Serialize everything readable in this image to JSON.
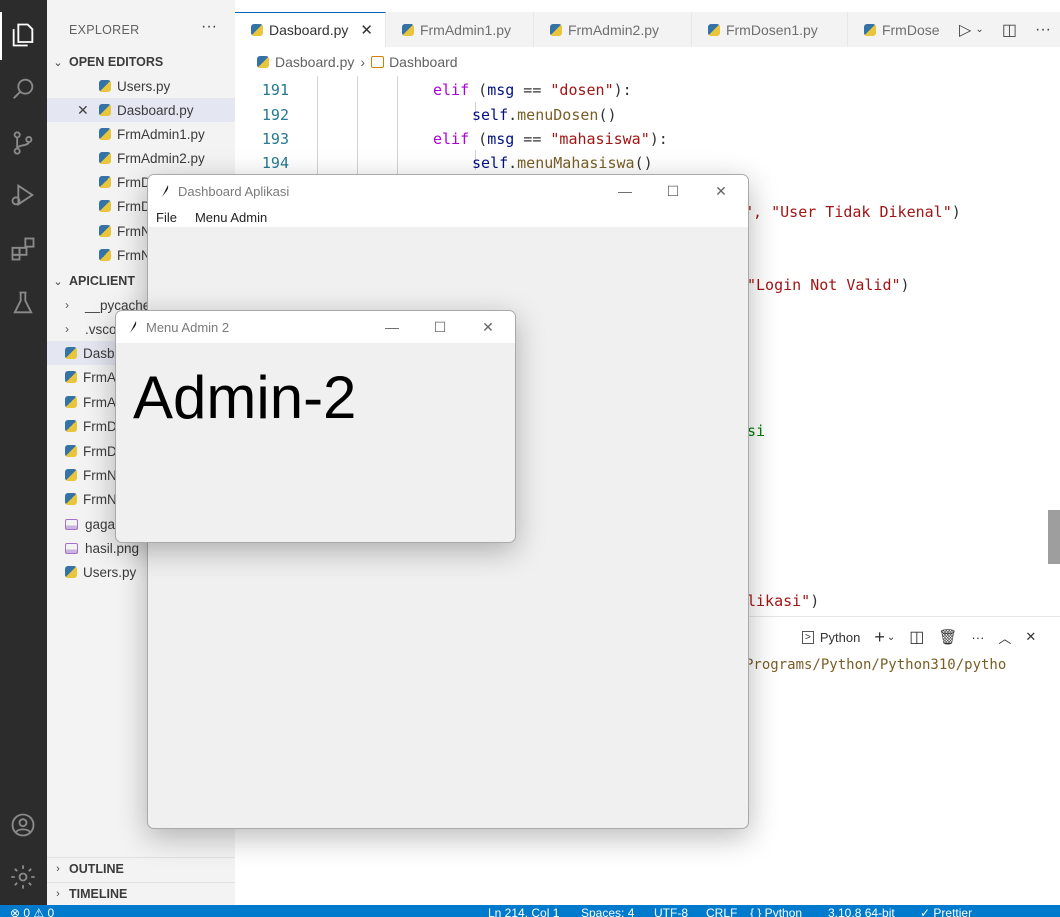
{
  "explorer": {
    "title": "EXPLORER",
    "more": "···",
    "open_editors_label": "OPEN EDITORS",
    "open_editors": [
      "Users.py",
      "Dasboard.py",
      "FrmAdmin1.py",
      "FrmAdmin2.py",
      "FrmD",
      "FrmD",
      "FrmN",
      "FrmN"
    ],
    "project_label": "APICLIENT",
    "project_items": [
      "__pycache",
      ".vsco",
      "Dasb",
      "FrmA",
      "FrmA",
      "FrmD",
      "FrmD",
      "FrmN",
      "FrmN",
      "gaga",
      "hasil.png",
      "Users.py"
    ],
    "outline_label": "OUTLINE",
    "timeline_label": "TIMELINE"
  },
  "tabs": [
    {
      "label": "Dasboard.py",
      "close": "✕"
    },
    {
      "label": "FrmAdmin1.py"
    },
    {
      "label": "FrmAdmin2.py"
    },
    {
      "label": "FrmDosen1.py"
    },
    {
      "label": "FrmDose"
    }
  ],
  "breadcrumb": {
    "file": "Dasboard.py",
    "sep": "›",
    "symbol": "Dashboard"
  },
  "code": {
    "lines": [
      {
        "num": "191"
      },
      {
        "num": "192"
      },
      {
        "num": "193"
      },
      {
        "num": "194"
      }
    ],
    "t191a": "elif",
    "t191b": " (",
    "t191c": "msg",
    "t191d": " == ",
    "t191e": "\"dosen\"",
    "t191f": "):",
    "t192a": "self",
    "t192b": ".",
    "t192c": "menuDosen",
    "t192d": "()",
    "t193a": "elif",
    "t193b": " (",
    "t193c": "msg",
    "t193d": " == ",
    "t193e": "\"mahasiswa\"",
    "t193f": "):",
    "t194a": "self",
    "t194b": ".",
    "t194c": "menuMahasiswa",
    "t194d": "()",
    "frag1a": "o\", ",
    "frag1b": "\"User Tidak Dikenal\"",
    "frag1c": ")",
    "frag2a": "\"Login Not Valid\"",
    "frag2b": ")",
    "frag3": "si",
    "frag4a": "likasi\"",
    "frag4b": ")"
  },
  "terminal": {
    "python_label": "Python",
    "path_text": "Programs/Python/Python310/pytho"
  },
  "status": {
    "errors": "⊗ 0 ⚠ 0",
    "position": "Ln 214, Col 1",
    "spaces": "Spaces: 4",
    "encoding": "UTF-8",
    "eol": "CRLF",
    "language": "{ } Python",
    "interpreter": "3.10.8 64-bit",
    "prettier": "✓ Prettier"
  },
  "dashboard_window": {
    "title": "Dashboard Aplikasi",
    "menu": [
      "File",
      "Menu Admin"
    ]
  },
  "admin_window": {
    "title": "Menu Admin 2",
    "label": "Admin-2"
  }
}
